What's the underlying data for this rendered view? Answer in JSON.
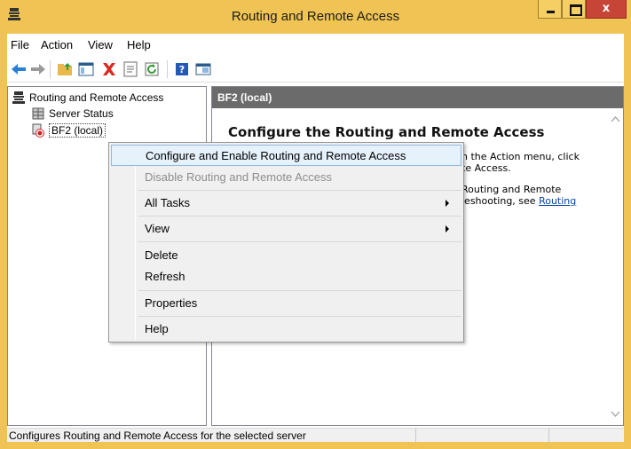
{
  "window": {
    "title": "Routing and Remote Access",
    "close_glyph": "x"
  },
  "menubar": [
    "File",
    "Action",
    "View",
    "Help"
  ],
  "toolbar_icons": [
    "back-icon",
    "forward-icon",
    "up-folder-icon",
    "show-hide-tree-icon",
    "delete-icon",
    "properties-icon",
    "refresh-icon",
    "help-icon",
    "console-icon"
  ],
  "tree": {
    "root": "Routing and Remote Access",
    "items": [
      "Server Status",
      "BF2 (local)"
    ]
  },
  "pane": {
    "header": "BF2 (local)",
    "heading": "Configure the Routing and Remote Access",
    "line1": "n the Action menu, click",
    "line2": "te Access.",
    "line3": "Routing and Remote",
    "line4_text": "leshooting, see ",
    "line4_link": "Routing"
  },
  "context_menu": [
    {
      "label": "Configure and Enable Routing and Remote Access",
      "highlighted": true
    },
    {
      "label": "Disable Routing and Remote Access",
      "disabled": true
    },
    {
      "label": "All Tasks",
      "submenu": true
    },
    {
      "label": "View",
      "submenu": true
    },
    {
      "label": "Delete"
    },
    {
      "label": "Refresh"
    },
    {
      "label": "Properties"
    },
    {
      "label": "Help"
    }
  ],
  "status": "Configures Routing and Remote Access for the selected server",
  "colors": {
    "title_accent": "#f0c454",
    "close_button": "#c74537",
    "pane_header": "#6b6b6b",
    "highlight": "#e5f1fb"
  }
}
